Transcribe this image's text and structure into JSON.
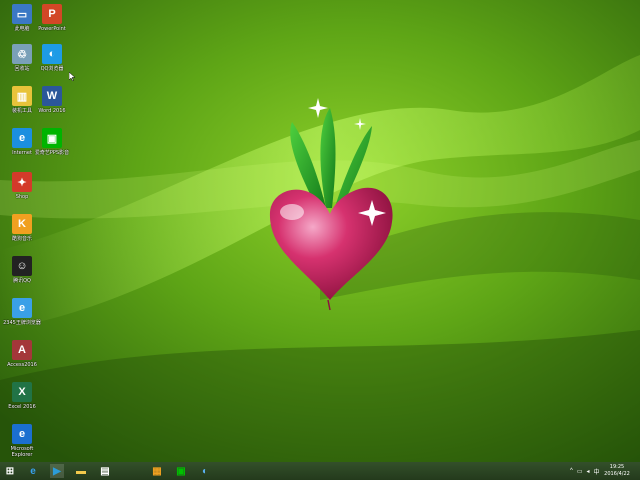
{
  "desktop": {
    "icons": [
      {
        "name": "computer",
        "label": "此电脑",
        "color": "#3b78c4",
        "glyph": "▭"
      },
      {
        "name": "powerpoint",
        "label": "PowerPoint",
        "color": "#d24726",
        "glyph": "P"
      },
      {
        "name": "recycle-bin",
        "label": "回收站",
        "color": "#7aa0b8",
        "glyph": "♲"
      },
      {
        "name": "qq-browser",
        "label": "QQ浏览器",
        "color": "#1e9be6",
        "glyph": "◐"
      },
      {
        "name": "files",
        "label": "装机工具",
        "color": "#e8c33a",
        "glyph": "▥"
      },
      {
        "name": "word",
        "label": "Word 2016",
        "color": "#2b579a",
        "glyph": "W"
      },
      {
        "name": "ie",
        "label": "Internet",
        "color": "#1b8fe0",
        "glyph": "e"
      },
      {
        "name": "iqiyi",
        "label": "爱奇艺PPS影音",
        "color": "#00b400",
        "glyph": "▣"
      },
      {
        "name": "shop",
        "label": "Shop",
        "color": "#d43a2a",
        "glyph": "✦"
      },
      {
        "name": "kugou",
        "label": "酷狗音乐",
        "color": "#f0a020",
        "glyph": "K"
      },
      {
        "name": "qq",
        "label": "腾讯QQ",
        "color": "#222222",
        "glyph": "☺"
      },
      {
        "name": "browser-2345",
        "label": "2345王牌浏览器",
        "color": "#3aa0e8",
        "glyph": "e"
      },
      {
        "name": "access",
        "label": "Access2016",
        "color": "#a4373a",
        "glyph": "A"
      },
      {
        "name": "excel",
        "label": "Excel 2016",
        "color": "#217346",
        "glyph": "X"
      },
      {
        "name": "edge",
        "label": "Microsoft Explorer",
        "color": "#1b6fd0",
        "glyph": "e"
      }
    ]
  },
  "taskbar": {
    "buttons": [
      {
        "name": "start",
        "color": "#ffffff",
        "glyph": "⊞"
      },
      {
        "name": "ie",
        "color": "#37a0ef",
        "glyph": "e"
      },
      {
        "name": "media",
        "color": "#2c9cd8",
        "glyph": "▶"
      },
      {
        "name": "explorer",
        "color": "#f2c94c",
        "glyph": "▬"
      },
      {
        "name": "store",
        "color": "#ffffff",
        "glyph": "▤"
      },
      {
        "name": "package",
        "color": "#f0a020",
        "glyph": "▦"
      },
      {
        "name": "iqiyi",
        "color": "#00c000",
        "glyph": "▣"
      },
      {
        "name": "qq-browser",
        "color": "#5ab0f0",
        "glyph": "◐"
      }
    ],
    "tray": {
      "icons": [
        {
          "name": "chevron-up",
          "glyph": "^"
        },
        {
          "name": "network",
          "glyph": "▭"
        },
        {
          "name": "volume",
          "glyph": "◂"
        },
        {
          "name": "ime",
          "glyph": "中"
        }
      ]
    },
    "clock": {
      "time": "19:25",
      "date": "2016/4/22"
    }
  }
}
